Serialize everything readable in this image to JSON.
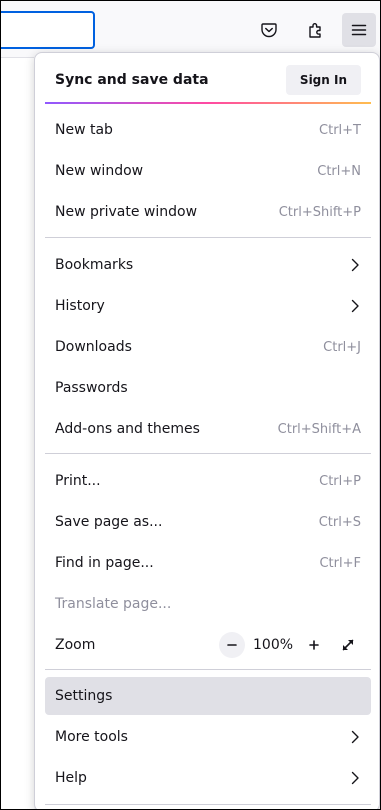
{
  "menu": {
    "sync_label": "Sync and save data",
    "sign_in": "Sign In",
    "items": [
      {
        "label": "New tab",
        "shortcut": "Ctrl+T"
      },
      {
        "label": "New window",
        "shortcut": "Ctrl+N"
      },
      {
        "label": "New private window",
        "shortcut": "Ctrl+Shift+P"
      },
      {
        "label": "Bookmarks"
      },
      {
        "label": "History"
      },
      {
        "label": "Downloads",
        "shortcut": "Ctrl+J"
      },
      {
        "label": "Passwords"
      },
      {
        "label": "Add-ons and themes",
        "shortcut": "Ctrl+Shift+A"
      },
      {
        "label": "Print...",
        "shortcut": "Ctrl+P"
      },
      {
        "label": "Save page as...",
        "shortcut": "Ctrl+S"
      },
      {
        "label": "Find in page...",
        "shortcut": "Ctrl+F"
      },
      {
        "label": "Translate page..."
      },
      {
        "label": "Zoom"
      },
      {
        "label": "Settings"
      },
      {
        "label": "More tools"
      },
      {
        "label": "Help"
      }
    ],
    "zoom_value": "100%",
    "zoom_minus": "−",
    "zoom_plus": "+"
  },
  "toolbar": {
    "icons": [
      "pocket-icon",
      "extensions-icon",
      "hamburger-menu-icon"
    ]
  },
  "colors": {
    "accent": "#0061e0",
    "hover": "#e0e0e6",
    "shortcut": "#8f8f9d"
  }
}
